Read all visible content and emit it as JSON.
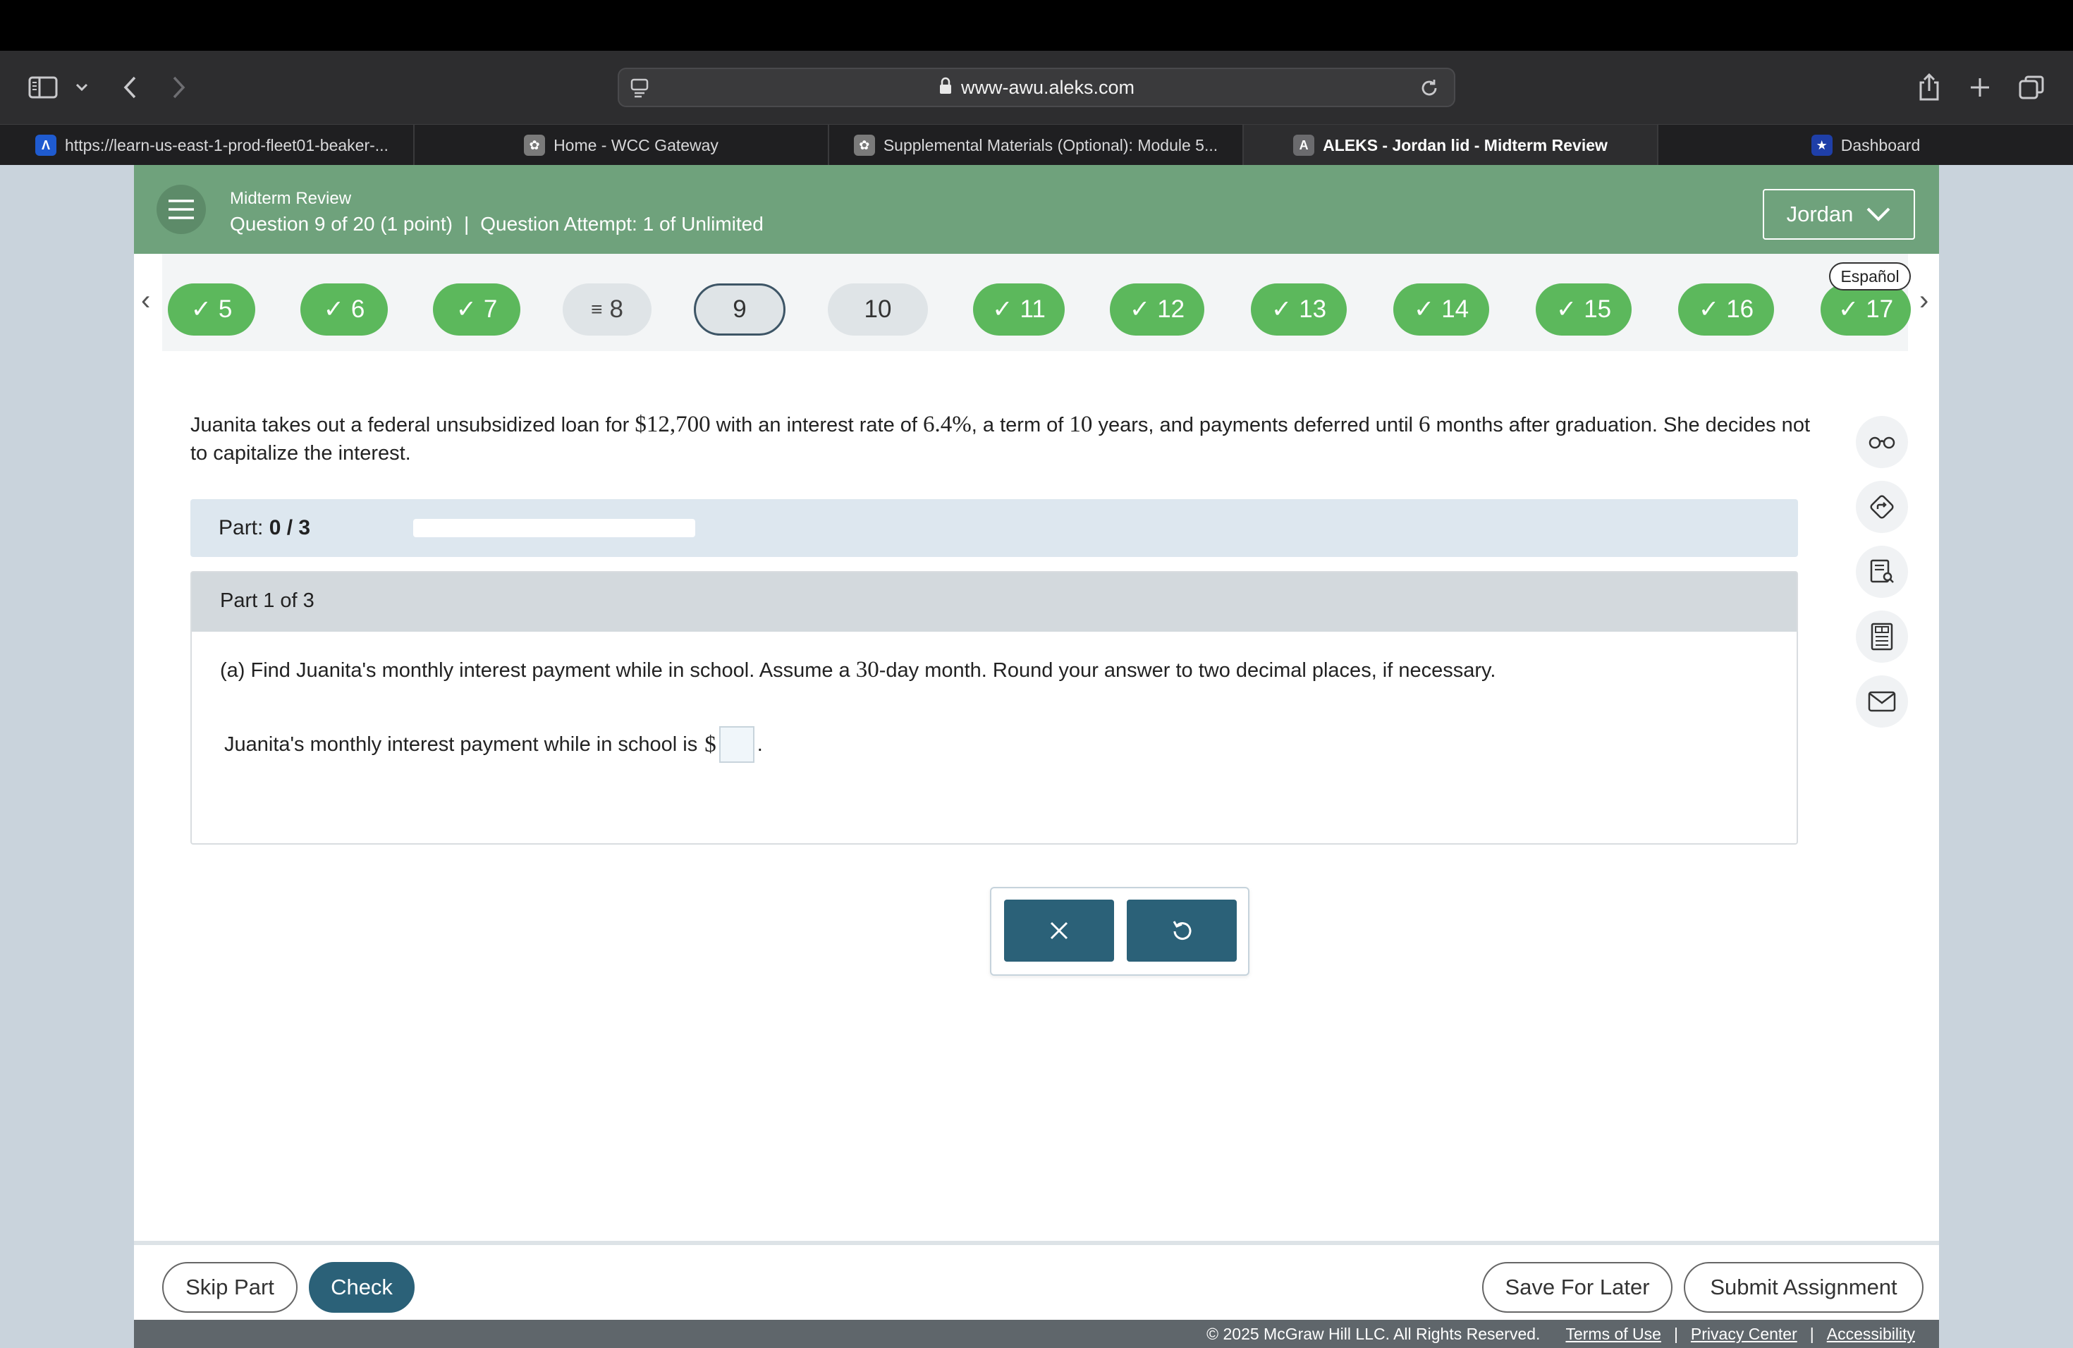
{
  "browser": {
    "url": "www-awu.aleks.com",
    "tabs": [
      {
        "label": "https://learn-us-east-1-prod-fleet01-beaker-...",
        "favicon": "aleks-logo-icon",
        "favicon_color": "#1f5bd0"
      },
      {
        "label": "Home - WCC Gateway",
        "favicon": "wcc-gateway-icon",
        "favicon_color": "#7a7a7a"
      },
      {
        "label": "Supplemental Materials (Optional): Module 5...",
        "favicon": "wcc-gateway-icon",
        "favicon_color": "#7a7a7a"
      },
      {
        "label": "ALEKS - Jordan lid - Midterm Review",
        "favicon": "aleks-a-icon",
        "favicon_glyph": "A",
        "favicon_color": "#6b6b6e",
        "active": true
      },
      {
        "label": "Dashboard",
        "favicon": "star-badge-icon",
        "favicon_color": "#1f3fa8"
      }
    ]
  },
  "header": {
    "title": "Midterm Review",
    "question_info": "Question 9 of 20 (1 point)",
    "separator": "|",
    "attempt_info": "Question Attempt: 1 of Unlimited",
    "user_name": "Jordan",
    "color": "#6fa27c"
  },
  "question_nav": {
    "items": [
      {
        "number": "5",
        "status": "correct"
      },
      {
        "number": "6",
        "status": "correct"
      },
      {
        "number": "7",
        "status": "correct"
      },
      {
        "number": "8",
        "status": "review"
      },
      {
        "number": "9",
        "status": "current"
      },
      {
        "number": "10",
        "status": "unanswered"
      },
      {
        "number": "11",
        "status": "correct"
      },
      {
        "number": "12",
        "status": "correct"
      },
      {
        "number": "13",
        "status": "correct"
      },
      {
        "number": "14",
        "status": "correct"
      },
      {
        "number": "15",
        "status": "correct"
      },
      {
        "number": "16",
        "status": "correct"
      },
      {
        "number": "17",
        "status": "correct"
      }
    ],
    "language_label": "Español",
    "correct_color": "#5cb85c"
  },
  "question": {
    "text_1": "Juanita takes out a federal unsubsidized loan for ",
    "amount": "$12,700",
    "text_2": " with an interest rate of ",
    "rate": "6.4%",
    "text_3": ", a term of ",
    "term": "10",
    "text_4": " years, and payments deferred until ",
    "defer": "6",
    "text_5": " months after graduation. She decides not to capitalize the interest."
  },
  "part_progress": {
    "label": "Part:",
    "value": "0 / 3",
    "fraction": 0
  },
  "part": {
    "header": "Part 1 of 3",
    "prompt_1": "(a) Find Juanita's monthly interest payment while in school. Assume a ",
    "days": "30",
    "prompt_2": "-day month. Round your answer to two decimal places, if necessary.",
    "answer_prefix": "Juanita's monthly interest payment while in school is ",
    "currency": "$",
    "answer_value": "",
    "answer_suffix": "."
  },
  "footer": {
    "skip_label": "Skip Part",
    "check_label": "Check",
    "save_label": "Save For Later",
    "submit_label": "Submit Assignment",
    "copyright": "© 2025 McGraw Hill LLC. All Rights Reserved.",
    "terms": "Terms of Use",
    "privacy": "Privacy Center",
    "accessibility": "Accessibility",
    "divider": "|",
    "accent_color": "#2b6178"
  }
}
